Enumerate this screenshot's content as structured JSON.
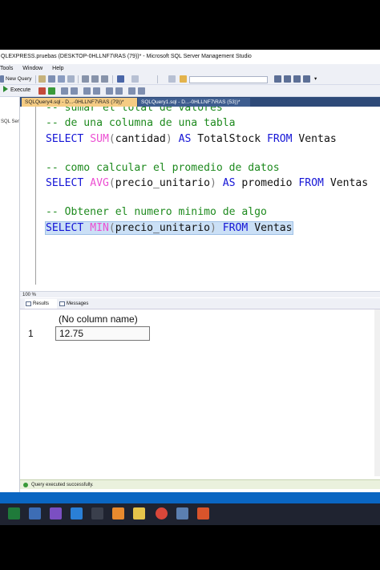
{
  "window": {
    "title": "QLEXPRESS.pruebas (DESKTOP-0HLLNF7\\RAS (79))* - Microsoft SQL Server Management Studio"
  },
  "menu": {
    "items": [
      "Tools",
      "Window",
      "Help"
    ]
  },
  "toolbar": {
    "new_query_label": "New Query",
    "execute_label": "Execute"
  },
  "object_explorer": {
    "header": "SQL Serve"
  },
  "tabs": [
    {
      "label": "SQLQuery4.sql - D...-0HLLNF7\\RAS (79))*",
      "active": true
    },
    {
      "label": "SQLQuery1.sql - D...-0HLLNF7\\RAS (53))*",
      "active": false
    }
  ],
  "editor": {
    "lines": [
      {
        "comment": "-- sumar el total de valores"
      },
      {
        "comment": "-- de una columna de una tabla"
      },
      {
        "kw1": "SELECT ",
        "fn": "SUM",
        "p1": "(",
        "arg": "cantidad",
        "p2": ")",
        "kw2": " AS ",
        "alias": "TotalStock",
        "kw3": " FROM ",
        "table": "Ventas"
      },
      {
        "comment": "-- como calcular el promedio de datos"
      },
      {
        "kw1": "SELECT ",
        "fn": "AVG",
        "p1": "(",
        "arg": "precio_unitario",
        "p2": ")",
        "kw2": " AS ",
        "alias": "promedio",
        "kw3": " FROM ",
        "table": "Ventas"
      },
      {
        "comment": "-- Obtener el numero minimo de algo"
      },
      {
        "kw1": "SELECT ",
        "fn": "MIN",
        "p1": "(",
        "arg": "precio_unitario",
        "p2": ")",
        "kw3": " FROM ",
        "table": "Ventas"
      }
    ]
  },
  "zoom": "100 %",
  "results": {
    "tabs": [
      "Results",
      "Messages"
    ],
    "column_header": "(No column name)",
    "row_number": "1",
    "cell_value": "12.75"
  },
  "status": {
    "message": "Query executed successfully."
  },
  "colors": {
    "comment": "#1e8a1e",
    "keyword": "#1515d6",
    "function": "#ec4fd2",
    "tab_active": "#f5cc84",
    "tabstrip": "#2e4a78",
    "accent_bar": "#0a66c2"
  }
}
